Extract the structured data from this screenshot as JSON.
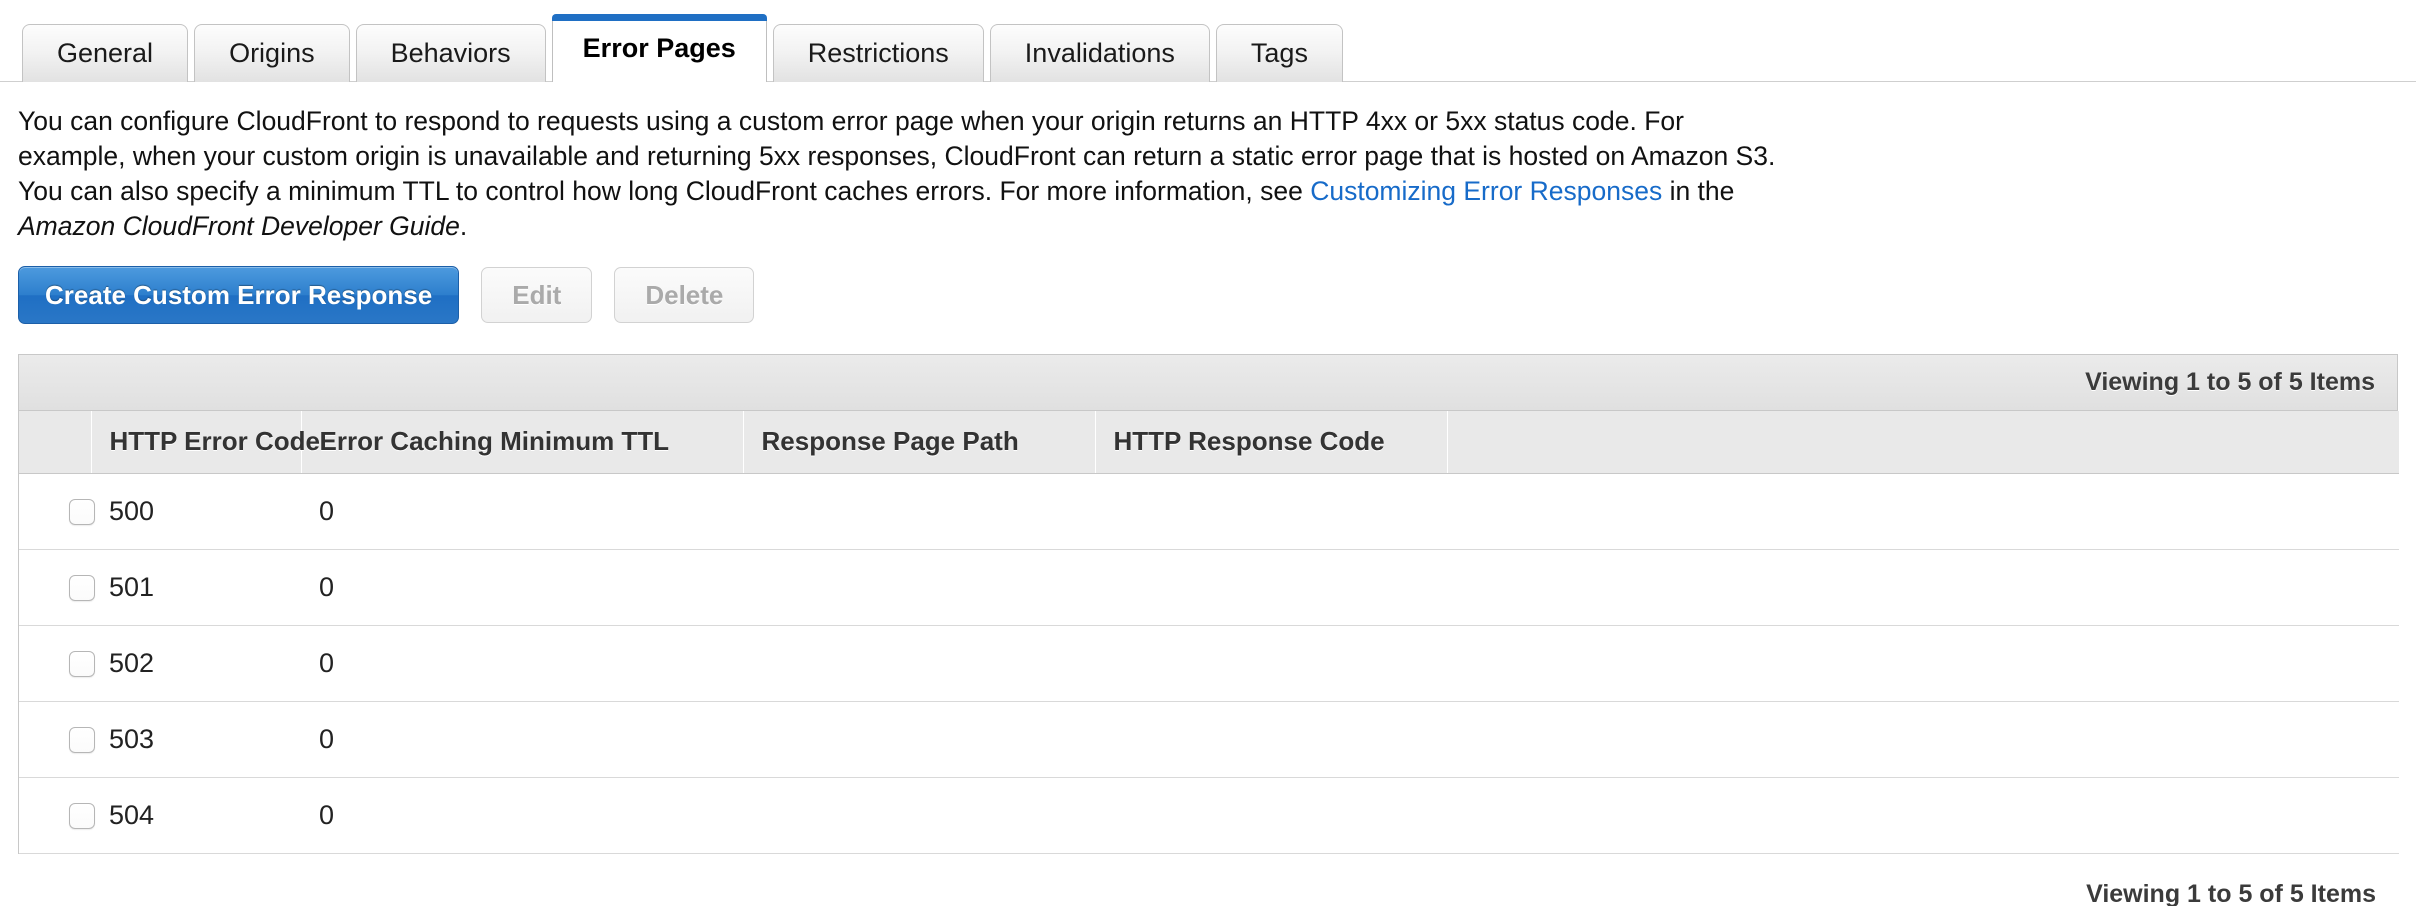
{
  "tabs": [
    {
      "label": "General",
      "active": false
    },
    {
      "label": "Origins",
      "active": false
    },
    {
      "label": "Behaviors",
      "active": false
    },
    {
      "label": "Error Pages",
      "active": true
    },
    {
      "label": "Restrictions",
      "active": false
    },
    {
      "label": "Invalidations",
      "active": false
    },
    {
      "label": "Tags",
      "active": false
    }
  ],
  "description": {
    "part1": "You can configure CloudFront to respond to requests using a custom error page when your origin returns an HTTP 4xx or 5xx status code. For example, when your custom origin is unavailable and returning 5xx responses, CloudFront can return a static error page that is hosted on Amazon S3. You can also specify a minimum TTL to control how long CloudFront caches errors. For more information, see ",
    "link_text": "Customizing Error Responses",
    "part2": " in the ",
    "guide_name": "Amazon CloudFront Developer Guide",
    "part3": "."
  },
  "toolbar": {
    "create_label": "Create Custom Error Response",
    "edit_label": "Edit",
    "delete_label": "Delete"
  },
  "table": {
    "viewing_top": "Viewing 1 to 5 of 5 Items",
    "viewing_bottom": "Viewing 1 to 5 of 5 Items",
    "columns": [
      "",
      "HTTP Error Code",
      "Error Caching Minimum TTL",
      "Response Page Path",
      "HTTP Response Code",
      ""
    ],
    "rows": [
      {
        "http_error_code": "500",
        "error_caching_minimum_ttl": "0",
        "response_page_path": "",
        "http_response_code": ""
      },
      {
        "http_error_code": "501",
        "error_caching_minimum_ttl": "0",
        "response_page_path": "",
        "http_response_code": ""
      },
      {
        "http_error_code": "502",
        "error_caching_minimum_ttl": "0",
        "response_page_path": "",
        "http_response_code": ""
      },
      {
        "http_error_code": "503",
        "error_caching_minimum_ttl": "0",
        "response_page_path": "",
        "http_response_code": ""
      },
      {
        "http_error_code": "504",
        "error_caching_minimum_ttl": "0",
        "response_page_path": "",
        "http_response_code": ""
      }
    ]
  },
  "colors": {
    "accent_blue": "#1f6fc4",
    "link_blue": "#176bc9",
    "button_blue": "#2d7fcd",
    "header_gray": "#e9e9e9",
    "border_gray": "#c8c8c8"
  }
}
